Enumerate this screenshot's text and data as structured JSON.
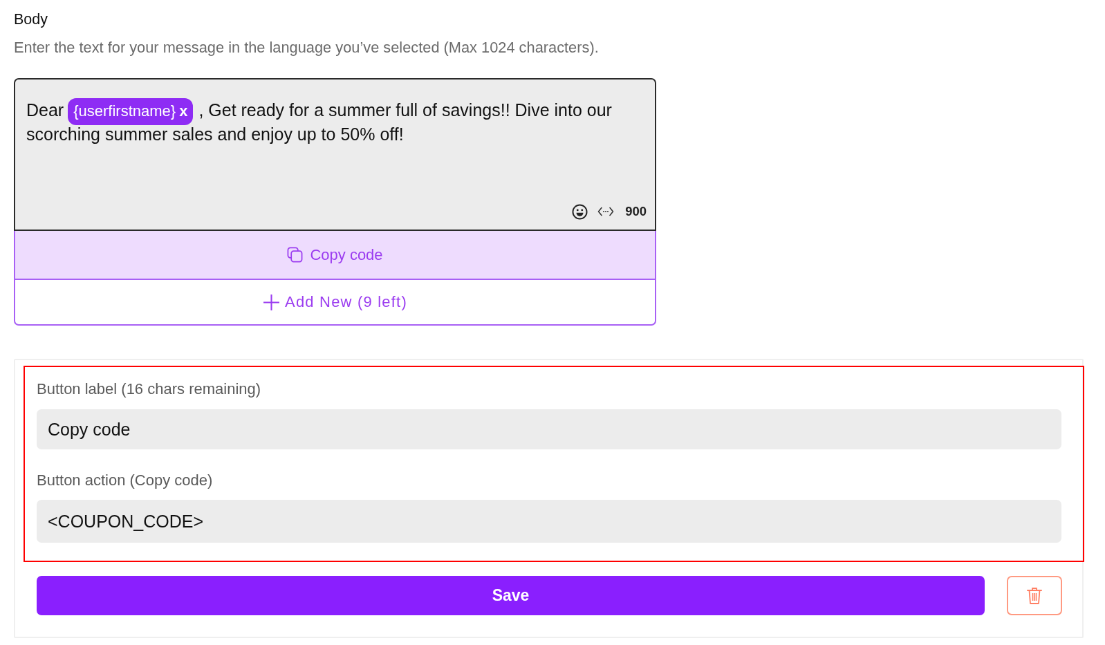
{
  "body_section": {
    "title": "Body",
    "hint": "Enter the text for your message in the language you’ve selected (Max 1024 characters)."
  },
  "editor": {
    "segments": [
      {
        "kind": "text",
        "text": "Dear"
      },
      {
        "kind": "variable",
        "text": "{userfirstname}",
        "remove_label": "x"
      },
      {
        "kind": "text",
        "text": ", Get ready for a summer full of savings!! Dive into our"
      },
      {
        "kind": "line",
        "text": "scorching summer sales and enjoy up to 50% off!"
      }
    ],
    "char_count": "900"
  },
  "buttons_list": [
    {
      "label": "Copy code",
      "selected": true
    }
  ],
  "add_button": {
    "label": "Add New (9 left)"
  },
  "button_form": {
    "highlighted": true,
    "fields": [
      {
        "label": "Button label (16 chars remaining)",
        "value": "Copy code"
      },
      {
        "label": "Button action (Copy code)",
        "value": "<COUPON_CODE>"
      }
    ]
  },
  "save_button": {
    "label": "Save"
  }
}
